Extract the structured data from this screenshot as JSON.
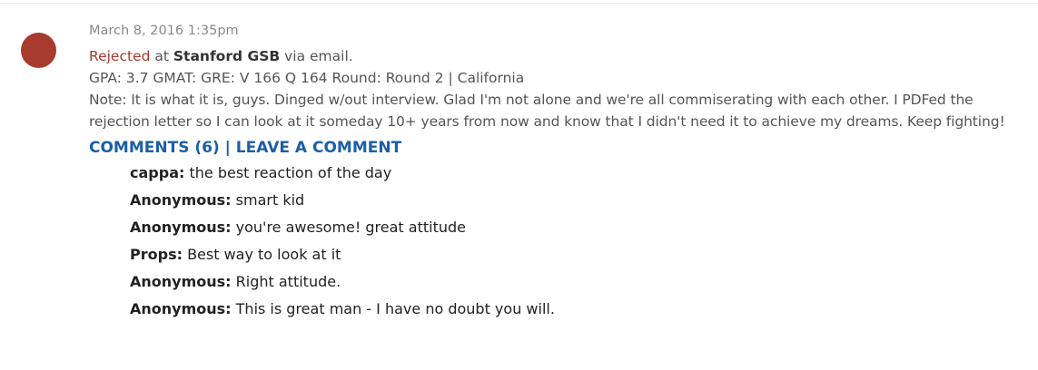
{
  "entry": {
    "date": "March 8, 2016 1:35pm",
    "decision": "Rejected",
    "at_text": " at ",
    "school": "Stanford GSB",
    "via_text": " via email.",
    "stats": "GPA: 3.7 GMAT: GRE: V 166 Q 164 Round: Round 2 | California",
    "note": "Note: It is what it is, guys. Dinged w/out interview. Glad I'm not alone and we're all commiserating with each other. I PDFed the rejection letter so I can look at it someday 10+ years from now and know that I didn't need it to achieve my dreams. Keep fighting!"
  },
  "comments_bar": {
    "comments_label": "COMMENTS (6)",
    "separator": " | ",
    "leave_label": "LEAVE A COMMENT"
  },
  "comments": [
    {
      "author": "cappa:",
      "text": " the best reaction of the day"
    },
    {
      "author": "Anonymous:",
      "text": " smart kid"
    },
    {
      "author": "Anonymous:",
      "text": " you're awesome! great attitude"
    },
    {
      "author": "Props:",
      "text": " Best way to look at it"
    },
    {
      "author": "Anonymous:",
      "text": " Right attitude."
    },
    {
      "author": "Anonymous:",
      "text": " This is great man - I have no doubt you will."
    }
  ],
  "colors": {
    "avatar": "#a83a2e",
    "decision": "#a83a2e",
    "link": "#1b5ea8"
  }
}
